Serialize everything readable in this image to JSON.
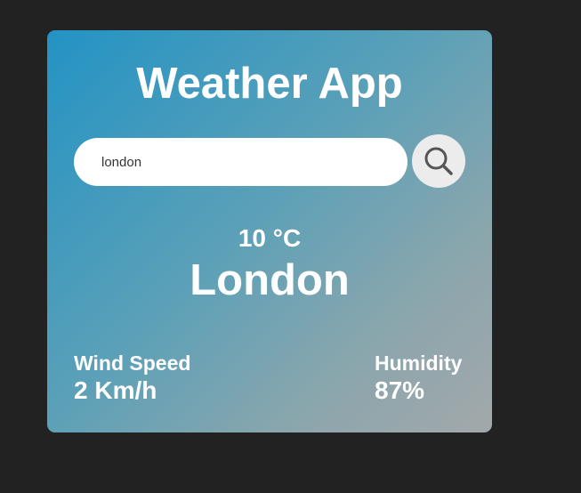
{
  "app": {
    "title": "Weather App"
  },
  "search": {
    "value": "london",
    "button_icon": "search-icon"
  },
  "weather": {
    "temperature": "10 °C",
    "city": "London"
  },
  "details": {
    "wind_label": "Wind Speed",
    "wind_value": "2 Km/h",
    "humidity_label": "Humidity",
    "humidity_value": "87%"
  },
  "colors": {
    "page_background": "#222222",
    "card_gradient_start": "#2393c4",
    "card_gradient_end": "#a3a8aa",
    "text": "#ffffff",
    "search_button": "#ececec"
  }
}
